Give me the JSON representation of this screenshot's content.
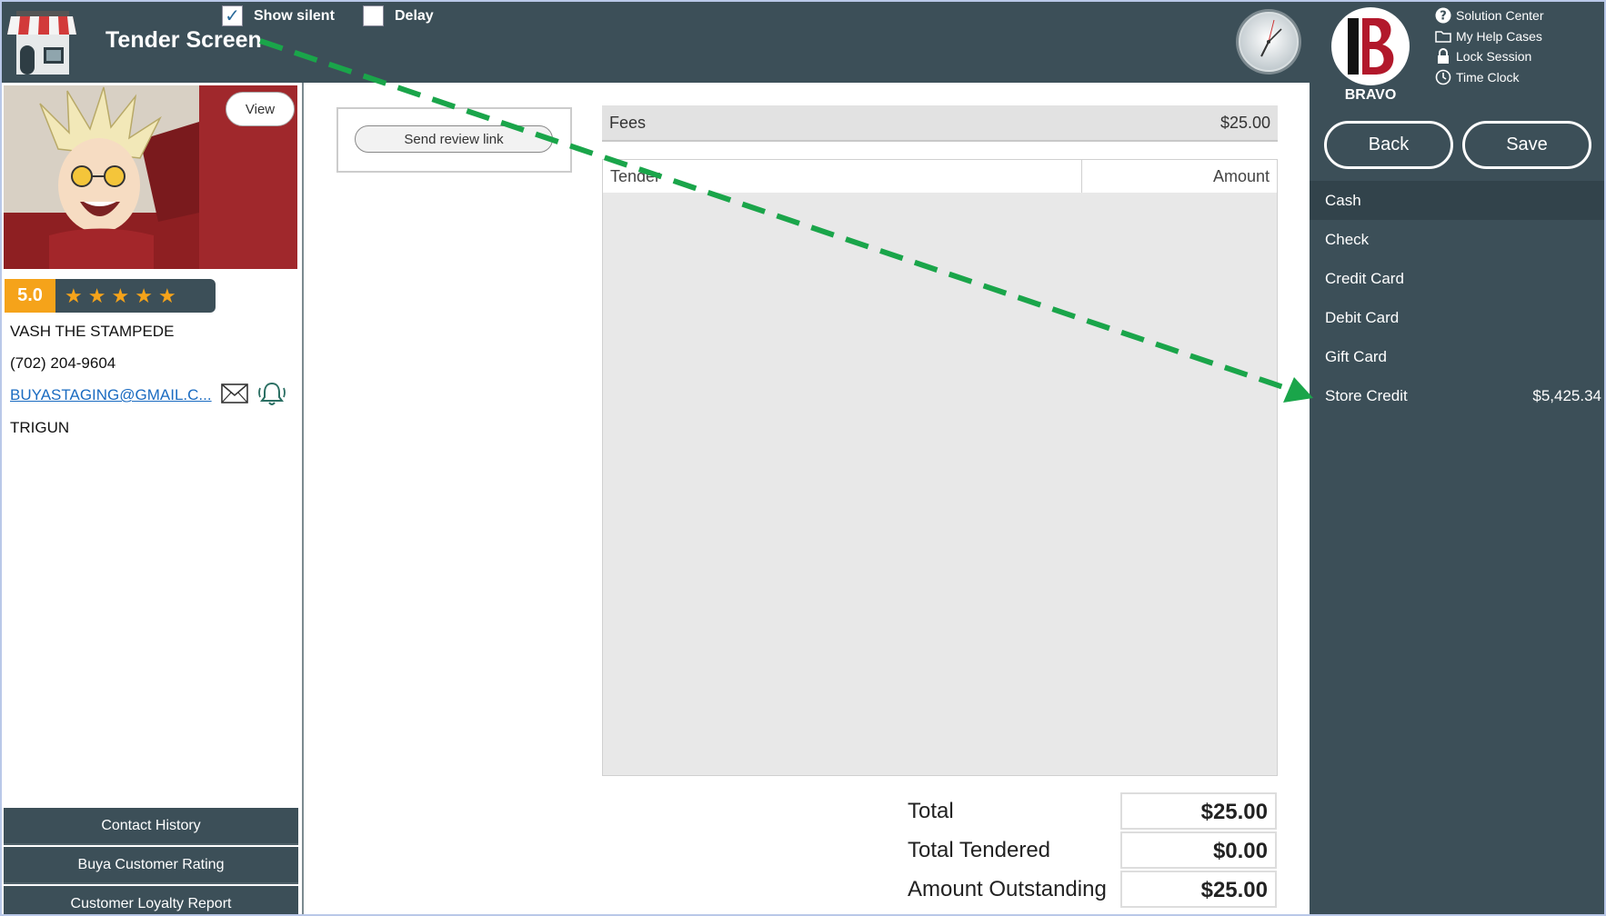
{
  "header": {
    "title": "Tender Screen",
    "show_silent": {
      "label": "Show silent",
      "checked": true
    },
    "delay": {
      "label": "Delay",
      "checked": false
    }
  },
  "brand": {
    "name": "BRAVO"
  },
  "quick_links": [
    {
      "label": "Solution Center",
      "icon": "help-icon"
    },
    {
      "label": "My Help Cases",
      "icon": "folder-icon"
    },
    {
      "label": "Lock Session",
      "icon": "lock-icon"
    },
    {
      "label": "Time Clock",
      "icon": "clock-icon"
    }
  ],
  "actions": {
    "back": "Back",
    "save": "Save"
  },
  "tender_types": [
    {
      "label": "Cash",
      "amount": "",
      "selected": true
    },
    {
      "label": "Check",
      "amount": ""
    },
    {
      "label": "Credit Card",
      "amount": ""
    },
    {
      "label": "Debit Card",
      "amount": ""
    },
    {
      "label": "Gift Card",
      "amount": ""
    },
    {
      "label": "Store Credit",
      "amount": "$5,425.34"
    }
  ],
  "customer": {
    "view_label": "View",
    "rating": "5.0",
    "stars": 5,
    "name": "VASH THE STAMPEDE",
    "phone": "(702) 204-9604",
    "email": "BUYASTAGING@GMAIL.C...",
    "note": "TRIGUN"
  },
  "left_buttons": {
    "contact_history": "Contact History",
    "customer_rating": "Buya Customer Rating",
    "loyalty_report": "Customer Loyalty Report"
  },
  "review": {
    "button": "Send review link"
  },
  "fees": {
    "label": "Fees",
    "amount": "$25.00"
  },
  "tender_table": {
    "col_tender": "Tender",
    "col_amount": "Amount"
  },
  "totals": {
    "total_label": "Total",
    "total_value": "$25.00",
    "tendered_label": "Total Tendered",
    "tendered_value": "$0.00",
    "outstanding_label": "Amount Outstanding",
    "outstanding_value": "$25.00"
  },
  "colors": {
    "header_bg": "#3c4f58",
    "accent_rating": "#f5a31a",
    "annotation_arrow": "#1aa54a",
    "photo_bg": "#a0282c"
  }
}
